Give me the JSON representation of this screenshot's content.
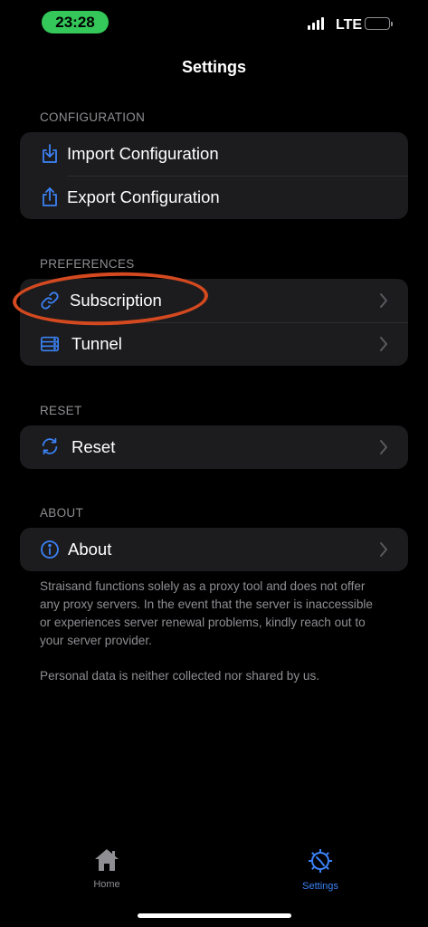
{
  "status_bar": {
    "time": "23:28",
    "network": "LTE"
  },
  "nav": {
    "title": "Settings"
  },
  "sections": {
    "configuration": {
      "header": "CONFIGURATION",
      "items": [
        {
          "label": "Import Configuration",
          "icon": "import-icon"
        },
        {
          "label": "Export Configuration",
          "icon": "export-icon"
        }
      ]
    },
    "preferences": {
      "header": "PREFERENCES",
      "items": [
        {
          "label": "Subscription",
          "icon": "link-icon"
        },
        {
          "label": "Tunnel",
          "icon": "server-icon"
        }
      ]
    },
    "reset": {
      "header": "RESET",
      "items": [
        {
          "label": "Reset",
          "icon": "refresh-icon"
        }
      ]
    },
    "about": {
      "header": "ABOUT",
      "items": [
        {
          "label": "About",
          "icon": "info-icon"
        }
      ],
      "footer": [
        "Straisand functions solely as a proxy tool and does not offer any proxy servers. In the event that the server is inaccessible or experiences server renewal problems, kindly reach out to your server provider.",
        "Personal data is neither collected nor shared by us."
      ]
    }
  },
  "tab_bar": {
    "tabs": [
      {
        "label": "Home",
        "icon": "house-icon",
        "active": false
      },
      {
        "label": "Settings",
        "icon": "gear-icon",
        "active": true
      }
    ]
  },
  "colors": {
    "accent": "#3b82f6",
    "background": "#000000",
    "card": "#1c1c1e",
    "secondary_text": "#8e8e93",
    "status_green": "#34c759",
    "annotation": "#d4491f"
  }
}
